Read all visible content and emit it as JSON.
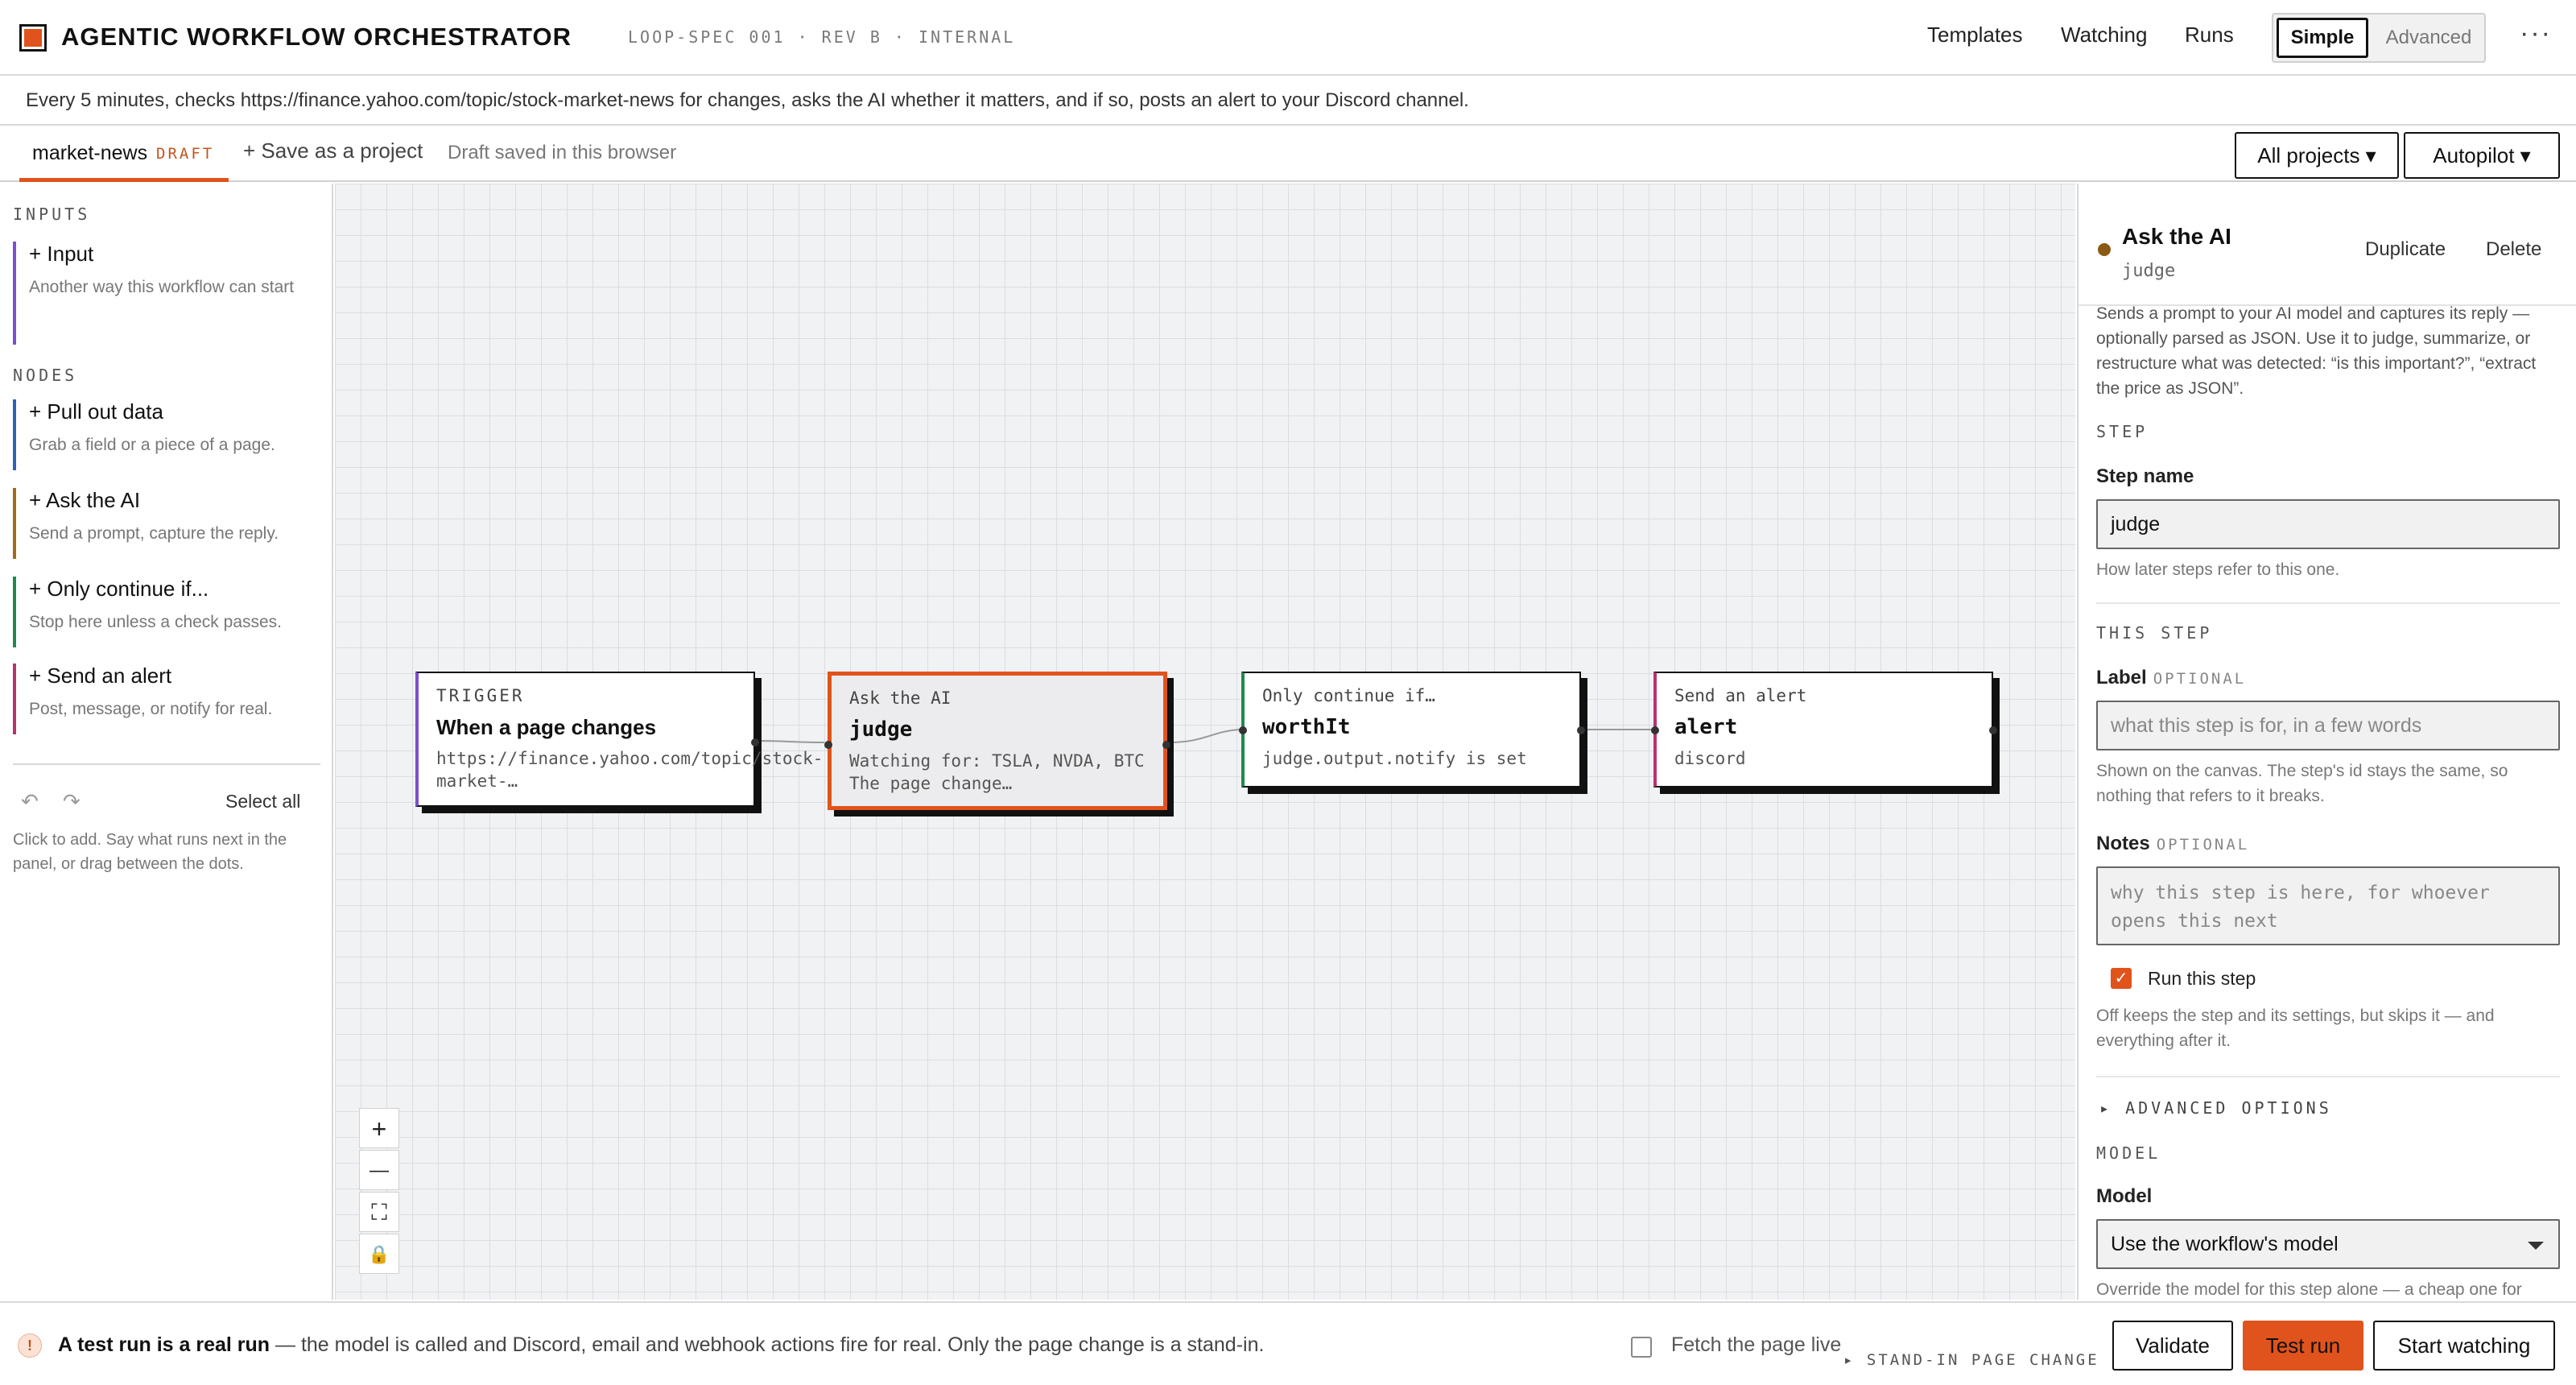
{
  "header": {
    "title": "AGENTIC WORKFLOW ORCHESTRATOR",
    "spec": "LOOP-SPEC 001 · REV B · INTERNAL",
    "nav": [
      "Templates",
      "Watching",
      "Runs"
    ],
    "mode_simple": "Simple",
    "mode_advanced": "Advanced",
    "more": "···"
  },
  "description": "Every 5 minutes, checks https://finance.yahoo.com/topic/stock-market-news for changes, asks the AI whether it matters, and if so, posts an alert to your Discord channel.",
  "tabbar": {
    "tab_name": "market-news",
    "tab_badge": "DRAFT",
    "save_project": "+ Save as a project",
    "draft_status": "Draft saved in this browser",
    "projects_dropdown": "All projects ▾",
    "autopilot_dropdown": "Autopilot ▾"
  },
  "sidebar": {
    "inputs_label": "INPUTS",
    "inputs": [
      {
        "title": "+ Input",
        "subtitle": "Another way this workflow can start",
        "color": "#7b4fcf"
      }
    ],
    "nodes_label": "NODES",
    "nodes": [
      {
        "title": "+ Pull out data",
        "subtitle": "Grab a field or a piece of a page.",
        "color": "#2a62b8"
      },
      {
        "title": "+ Ask the AI",
        "subtitle": "Send a prompt, capture the reply.",
        "color": "#a36a17"
      },
      {
        "title": "+ Only continue if...",
        "subtitle": "Stop here unless a check passes.",
        "color": "#1f8a4c"
      },
      {
        "title": "+ Send an alert",
        "subtitle": "Post, message, or notify for real.",
        "color": "#b8326e"
      }
    ],
    "undo": "↶",
    "redo": "↷",
    "select_all": "Select all",
    "hint": "Click to add. Say what runs next in the panel, or drag between the dots."
  },
  "canvas": {
    "nodes": [
      {
        "type": "TRIGGER",
        "name": "When a page changes",
        "sub": "https://finance.yahoo.com/topic/stock-market-…",
        "accent": "#7b4fcf"
      },
      {
        "type": "Ask the AI",
        "name": "judge",
        "sub": "Watching for: TSLA, NVDA, BTC The page change…",
        "accent": "#e0531c"
      },
      {
        "type": "Only continue if…",
        "name": "worthIt",
        "sub": "judge.output.notify is set",
        "accent": "#1f8a4c"
      },
      {
        "type": "Send an alert",
        "name": "alert",
        "sub": "discord",
        "accent": "#b8326e"
      }
    ],
    "zoom": {
      "in": "+",
      "out": "—",
      "fit": "⛶",
      "lock": "🔒"
    }
  },
  "panel": {
    "title": "Ask the AI",
    "id": "judge",
    "duplicate": "Duplicate",
    "delete": "Delete",
    "description": "Sends a prompt to your AI model and captures its reply — optionally parsed as JSON. Use it to judge, summarize, or restructure what was detected: “is this important?”, “extract the price as JSON”.",
    "step_section": "STEP",
    "step_name_label": "Step name",
    "step_name_value": "judge",
    "step_name_help": "How later steps refer to this one.",
    "this_step_section": "THIS STEP",
    "label_label": "Label",
    "optional": "OPTIONAL",
    "label_placeholder": "what this step is for, in a few words",
    "label_help": "Shown on the canvas. The step's id stays the same, so nothing that refers to it breaks.",
    "notes_label": "Notes",
    "notes_placeholder": "why this step is here, for whoever opens this next",
    "run_label": "Run this step",
    "run_help": "Off keeps the step and its settings, but skips it — and everything after it.",
    "advanced": "▸ ADVANCED OPTIONS",
    "model_section": "MODEL",
    "model_label": "Model",
    "model_value": "Use the workflow's model",
    "model_help": "Override the model for this step alone — a cheap one for"
  },
  "footer": {
    "warn_icon": "!",
    "bold": "A test run is a real run",
    "text": " — the model is called and Discord, email and webhook actions fire for real. Only the page change is a stand-in.",
    "fetch_live": "Fetch the page live",
    "standin": "▸ STAND-IN PAGE CHANGE",
    "validate": "Validate",
    "test_run": "Test run",
    "start_watching": "Start watching"
  },
  "colors": {
    "accent": "#e0531c",
    "ai": "#8a5a14"
  }
}
